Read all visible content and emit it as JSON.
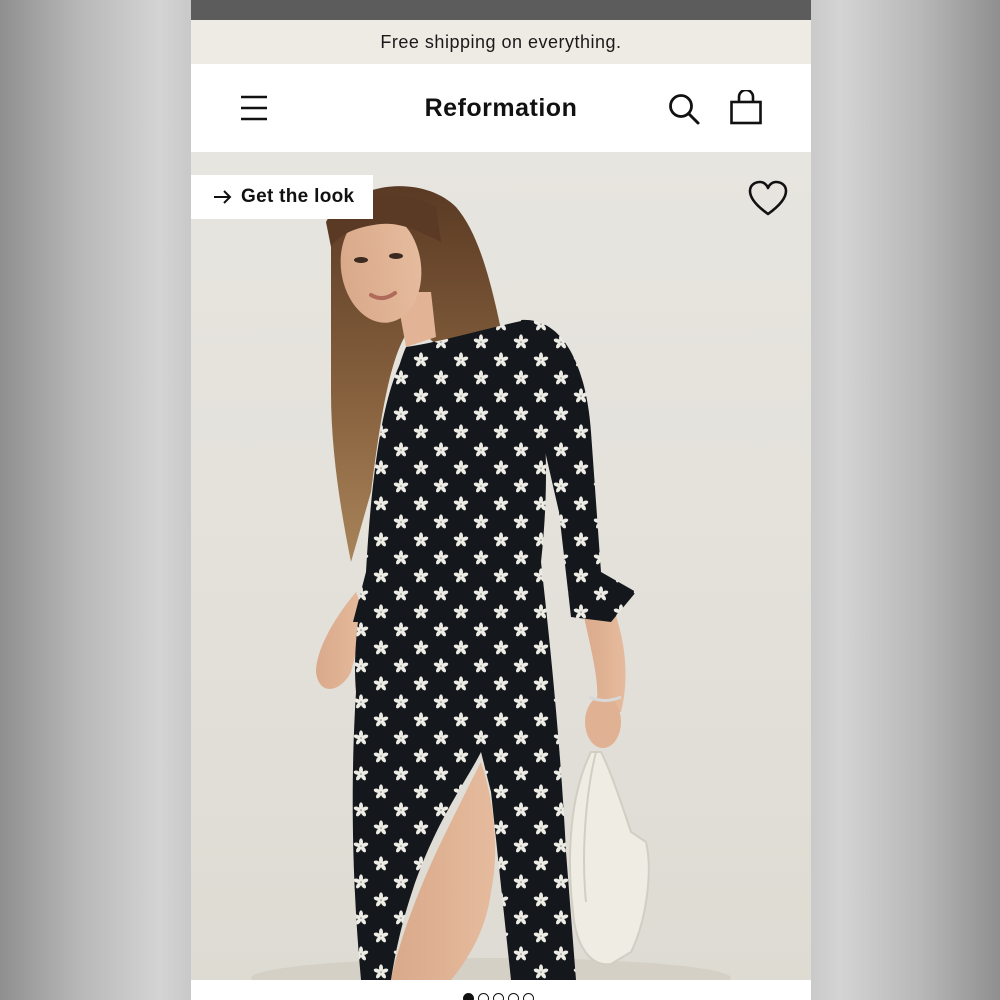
{
  "banner": {
    "text": "Free shipping on everything."
  },
  "header": {
    "brand": "Reformation",
    "menu_icon": "hamburger-menu-icon",
    "search_icon": "search-icon",
    "bag_icon": "shopping-bag-icon"
  },
  "product": {
    "get_the_look_label": "Get the look",
    "arrow_icon": "arrow-right-icon",
    "wishlist_icon": "heart-icon",
    "image_alt": "Model wearing black midi dress with white floral print, puff sleeves and side slit, holding a white shoulder bag"
  },
  "carousel": {
    "total_slides": 5,
    "active_slide": 1
  },
  "colors": {
    "status_bar": "#5c5c5c",
    "banner_bg": "#eeebe4",
    "dress": "#14181c",
    "photo_bg": "#e4e1da"
  }
}
